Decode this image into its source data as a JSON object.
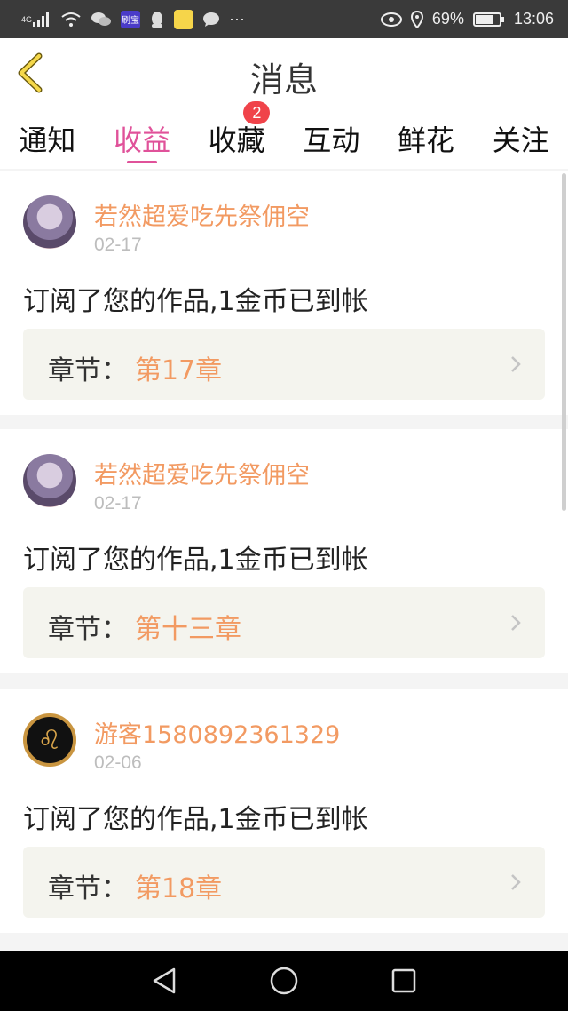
{
  "status_bar": {
    "network": "4G",
    "app_badge": "刷宝",
    "battery_percent": "69%",
    "time": "13:06",
    "dots": "···"
  },
  "header": {
    "title": "消息"
  },
  "tabs": [
    {
      "label": "通知"
    },
    {
      "label": "收益",
      "active": true
    },
    {
      "label": "收藏",
      "badge": "2"
    },
    {
      "label": "互动"
    },
    {
      "label": "鲜花"
    },
    {
      "label": "关注"
    }
  ],
  "messages": [
    {
      "username": "若然超爱吃先祭佣空",
      "date": "02-17",
      "text": "订阅了您的作品,1金币已到帐",
      "chapter_label": "章节：",
      "chapter": "第17章",
      "avatar": "anime-girl-avatar"
    },
    {
      "username": "若然超爱吃先祭佣空",
      "date": "02-17",
      "text": "订阅了您的作品,1金币已到帐",
      "chapter_label": "章节：",
      "chapter": "第十三章",
      "avatar": "anime-girl-avatar"
    },
    {
      "username": "游客1580892361329",
      "date": "02-06",
      "text": "订阅了您的作品,1金币已到帐",
      "chapter_label": "章节：",
      "chapter": "第18章",
      "avatar": "leo-zodiac-avatar"
    }
  ],
  "colors": {
    "accent": "#e0529a",
    "username": "#f29a62",
    "badge": "#f0434a"
  }
}
